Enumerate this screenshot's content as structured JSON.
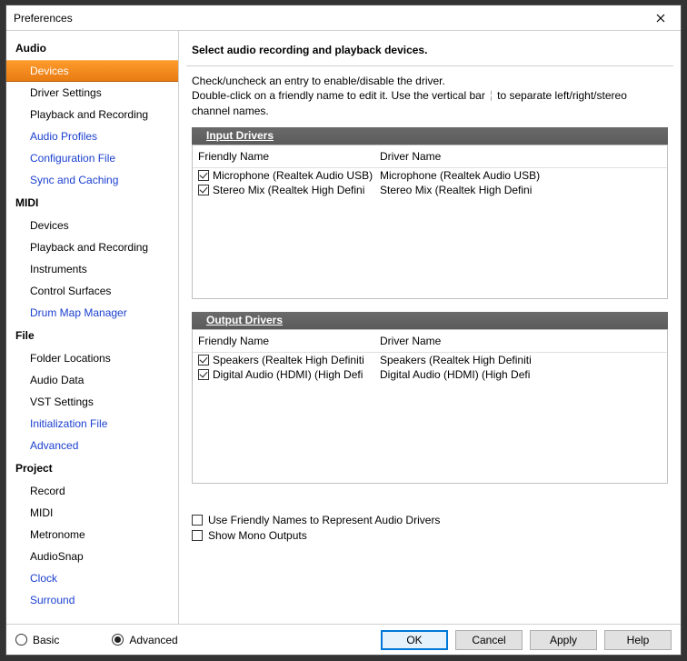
{
  "window": {
    "title": "Preferences"
  },
  "sidebar": {
    "groups": [
      {
        "label": "Audio",
        "items": [
          {
            "label": "Devices",
            "selected": true,
            "link": false
          },
          {
            "label": "Driver Settings",
            "link": false
          },
          {
            "label": "Playback and Recording",
            "link": false
          },
          {
            "label": "Audio Profiles",
            "link": true
          },
          {
            "label": "Configuration File",
            "link": true
          },
          {
            "label": "Sync and Caching",
            "link": true
          }
        ]
      },
      {
        "label": "MIDI",
        "items": [
          {
            "label": "Devices",
            "link": false
          },
          {
            "label": "Playback and Recording",
            "link": false
          },
          {
            "label": "Instruments",
            "link": false
          },
          {
            "label": "Control Surfaces",
            "link": false
          },
          {
            "label": "Drum Map Manager",
            "link": true
          }
        ]
      },
      {
        "label": "File",
        "items": [
          {
            "label": "Folder Locations",
            "link": false
          },
          {
            "label": "Audio Data",
            "link": false
          },
          {
            "label": "VST Settings",
            "link": false
          },
          {
            "label": "Initialization File",
            "link": true
          },
          {
            "label": "Advanced",
            "link": true
          }
        ]
      },
      {
        "label": "Project",
        "items": [
          {
            "label": "Record",
            "link": false
          },
          {
            "label": "MIDI",
            "link": false
          },
          {
            "label": "Metronome",
            "link": false
          },
          {
            "label": "AudioSnap",
            "link": false
          },
          {
            "label": "Clock",
            "link": true
          },
          {
            "label": "Surround",
            "link": true
          }
        ]
      }
    ]
  },
  "main": {
    "heading": "Select audio recording and playback devices.",
    "description_line1": "Check/uncheck an entry to enable/disable the driver.",
    "description_line2a": "Double-click on a friendly name to edit it. Use the vertical bar ",
    "description_line2b": " to separate left/right/stereo channel names.",
    "input_section_label": "Input Drivers",
    "output_section_label": "Output Drivers",
    "col_friendly": "Friendly Name",
    "col_driver": "Driver Name",
    "input_rows": [
      {
        "checked": true,
        "friendly": "Microphone (Realtek Audio USB)",
        "driver": "Microphone (Realtek Audio USB)"
      },
      {
        "checked": true,
        "friendly": "Stereo Mix (Realtek High Defini",
        "driver": "Stereo Mix (Realtek High Defini"
      }
    ],
    "output_rows": [
      {
        "checked": true,
        "friendly": "Speakers (Realtek High Definiti",
        "driver": "Speakers (Realtek High Definiti"
      },
      {
        "checked": true,
        "friendly": "Digital Audio (HDMI) (High Defi",
        "driver": "Digital Audio (HDMI) (High Defi"
      }
    ],
    "opt_friendly": "Use Friendly Names to Represent Audio Drivers",
    "opt_mono": "Show Mono Outputs"
  },
  "footer": {
    "basic": "Basic",
    "advanced": "Advanced",
    "ok": "OK",
    "cancel": "Cancel",
    "apply": "Apply",
    "help": "Help"
  }
}
